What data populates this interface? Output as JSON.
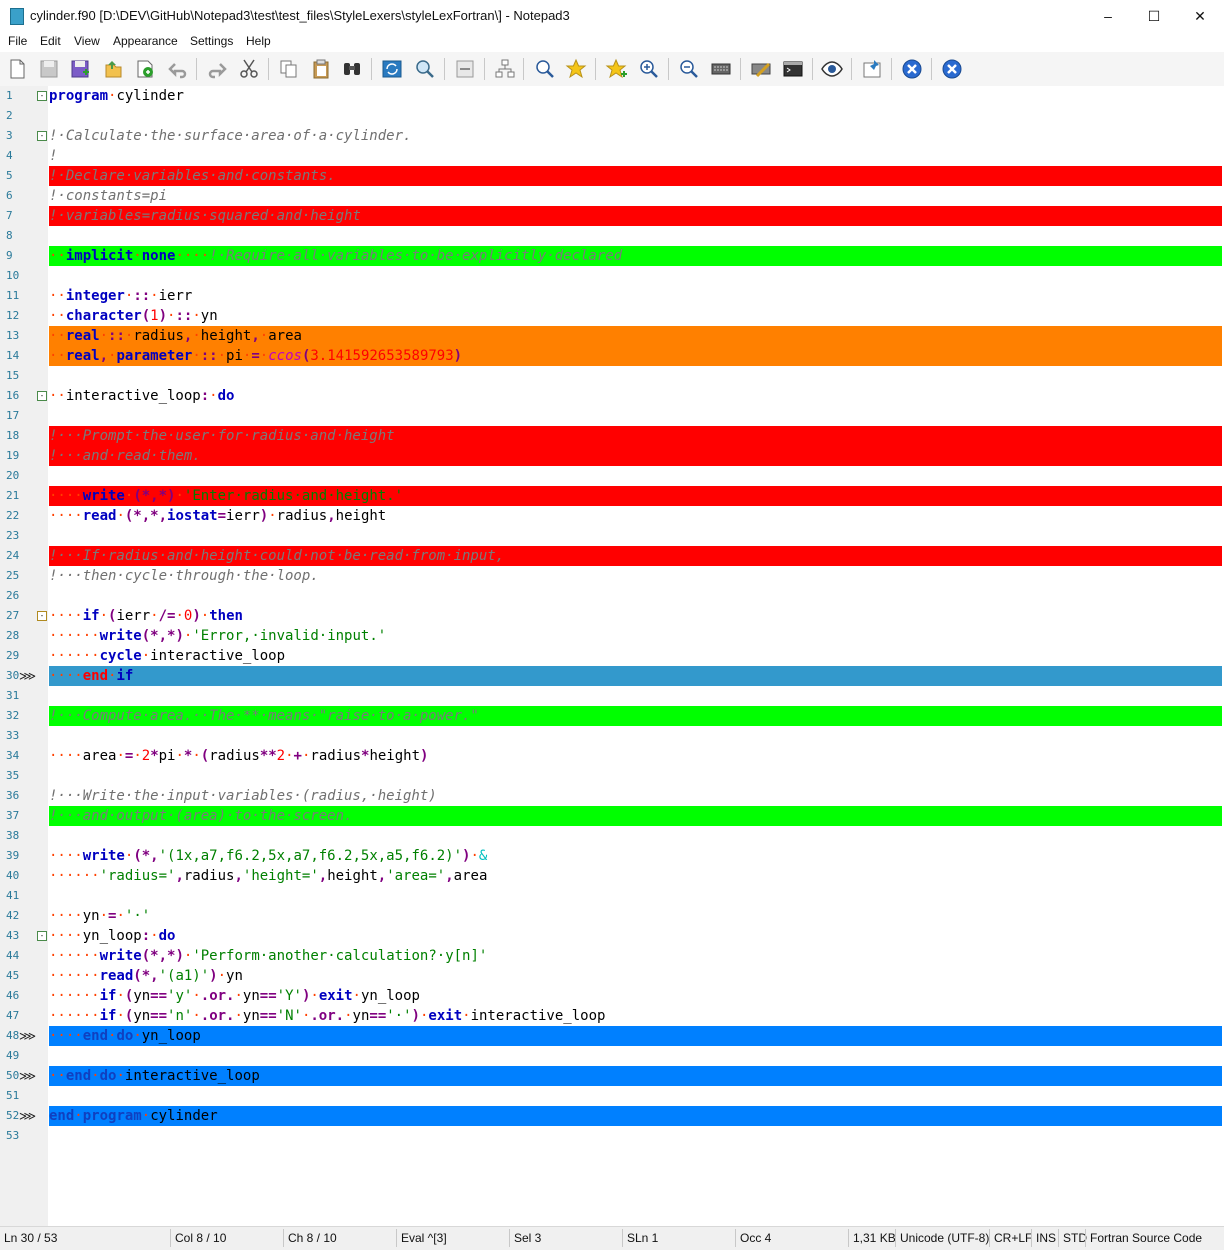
{
  "window": {
    "title": "cylinder.f90 [D:\\DEV\\GitHub\\Notepad3\\test\\test_files\\StyleLexers\\styleLexFortran\\] - Notepad3",
    "minimize": "–",
    "maximize": "☐",
    "close": "✕"
  },
  "menu": [
    "File",
    "Edit",
    "View",
    "Appearance",
    "Settings",
    "Help"
  ],
  "toolbar": [
    "new-file",
    "open",
    "save-disabled",
    "save-as",
    "save-copy",
    "open-favorites",
    "undo",
    "redo",
    "cut",
    "copy",
    "paste",
    "find",
    "replace",
    "goto-line",
    "wrap",
    "show-blanks",
    "lexer",
    "zoom-find",
    "favorites-star",
    "add-favorite",
    "zoom-in",
    "zoom-out",
    "keyboard",
    "customize",
    "terminal",
    "view",
    "pin",
    "exit"
  ],
  "colors": {
    "red": "#ff0000",
    "green": "#00ff00",
    "orange": "#ff8000",
    "caret": "#3399cc",
    "mark": "#0080ff",
    "keyword": "#0000c0",
    "comment": "#707070",
    "string": "#008000",
    "number": "#ff0000",
    "operator": "#800080",
    "ws": "#ff4000"
  },
  "lines": [
    {
      "n": "1",
      "fold": "-",
      "t": [
        [
          "kw",
          "program"
        ],
        [
          "ws",
          "·"
        ],
        [
          "id",
          "cylinder"
        ]
      ]
    },
    {
      "n": "2",
      "t": []
    },
    {
      "n": "3",
      "fold": "-",
      "t": [
        [
          "cm",
          "!·Calculate·the·surface·area·of·a·cylinder."
        ]
      ]
    },
    {
      "n": "4",
      "t": [
        [
          "cm",
          "!"
        ]
      ]
    },
    {
      "n": "5",
      "hl": "red",
      "t": [
        [
          "cm",
          "!·Declare·variables·and·constants."
        ]
      ]
    },
    {
      "n": "6",
      "t": [
        [
          "cm",
          "!·constants=pi"
        ]
      ]
    },
    {
      "n": "7",
      "hl": "red",
      "t": [
        [
          "cm",
          "!·variables=radius·squared·and·height"
        ]
      ]
    },
    {
      "n": "8",
      "t": []
    },
    {
      "n": "9",
      "hl": "green",
      "t": [
        [
          "ws",
          "··"
        ],
        [
          "kw",
          "implicit"
        ],
        [
          "ws",
          "·"
        ],
        [
          "kw",
          "none"
        ],
        [
          "ws",
          "····"
        ],
        [
          "cm",
          "!·Require·all·variables·to·be·explicitly·declared"
        ]
      ]
    },
    {
      "n": "10",
      "t": []
    },
    {
      "n": "11",
      "t": [
        [
          "ws",
          "··"
        ],
        [
          "kw",
          "integer"
        ],
        [
          "ws",
          "·"
        ],
        [
          "op",
          "::"
        ],
        [
          "ws",
          "·"
        ],
        [
          "id",
          "ierr"
        ]
      ]
    },
    {
      "n": "12",
      "t": [
        [
          "ws",
          "··"
        ],
        [
          "kw",
          "character"
        ],
        [
          "op",
          "("
        ],
        [
          "num",
          "1"
        ],
        [
          "op",
          ")"
        ],
        [
          "ws",
          "·"
        ],
        [
          "op",
          "::"
        ],
        [
          "ws",
          "·"
        ],
        [
          "id",
          "yn"
        ]
      ]
    },
    {
      "n": "13",
      "hl": "orange",
      "t": [
        [
          "ws",
          "··"
        ],
        [
          "kw",
          "real"
        ],
        [
          "ws",
          "·"
        ],
        [
          "op",
          "::"
        ],
        [
          "ws",
          "·"
        ],
        [
          "id",
          "radius"
        ],
        [
          "op",
          ","
        ],
        [
          "ws",
          "·"
        ],
        [
          "id",
          "height"
        ],
        [
          "op",
          ","
        ],
        [
          "ws",
          "·"
        ],
        [
          "id",
          "area"
        ]
      ]
    },
    {
      "n": "14",
      "hl": "orange",
      "t": [
        [
          "ws",
          "··"
        ],
        [
          "kw",
          "real"
        ],
        [
          "op",
          ","
        ],
        [
          "ws",
          "·"
        ],
        [
          "kw",
          "parameter"
        ],
        [
          "ws",
          "·"
        ],
        [
          "op",
          "::"
        ],
        [
          "ws",
          "·"
        ],
        [
          "id",
          "pi"
        ],
        [
          "ws",
          "·"
        ],
        [
          "op",
          "="
        ],
        [
          "ws",
          "·"
        ],
        [
          "fn",
          "ccos"
        ],
        [
          "op",
          "("
        ],
        [
          "num",
          "3.141592653589793"
        ],
        [
          "op",
          ")"
        ]
      ]
    },
    {
      "n": "15",
      "t": []
    },
    {
      "n": "16",
      "fold": "-",
      "t": [
        [
          "ws",
          "··"
        ],
        [
          "id",
          "interactive_loop"
        ],
        [
          "op",
          ":"
        ],
        [
          "ws",
          "·"
        ],
        [
          "kw",
          "do"
        ]
      ]
    },
    {
      "n": "17",
      "t": []
    },
    {
      "n": "18",
      "hl": "red",
      "t": [
        [
          "cm",
          "!···Prompt·the·user·for·radius·and·height"
        ]
      ]
    },
    {
      "n": "19",
      "hl": "red",
      "t": [
        [
          "cm",
          "!···and·read·them."
        ]
      ]
    },
    {
      "n": "20",
      "t": []
    },
    {
      "n": "21",
      "hl": "red",
      "t": [
        [
          "ws",
          "····"
        ],
        [
          "kw",
          "write"
        ],
        [
          "ws",
          "·"
        ],
        [
          "op",
          "(*,*)"
        ],
        [
          "ws",
          "·"
        ],
        [
          "str",
          "'Enter·radius·and·height.'"
        ]
      ]
    },
    {
      "n": "22",
      "t": [
        [
          "ws",
          "····"
        ],
        [
          "kw",
          "read"
        ],
        [
          "ws",
          "·"
        ],
        [
          "op",
          "(*,*,"
        ],
        [
          "kw",
          "iostat"
        ],
        [
          "op",
          "="
        ],
        [
          "id",
          "ierr"
        ],
        [
          "op",
          ")"
        ],
        [
          "ws",
          "·"
        ],
        [
          "id",
          "radius"
        ],
        [
          "op",
          ","
        ],
        [
          "id",
          "height"
        ]
      ]
    },
    {
      "n": "23",
      "t": []
    },
    {
      "n": "24",
      "hl": "red",
      "t": [
        [
          "cm",
          "!···If·radius·and·height·could·not·be·read·from·input,"
        ]
      ]
    },
    {
      "n": "25",
      "t": [
        [
          "cm",
          "!···then·cycle·through·the·loop."
        ]
      ]
    },
    {
      "n": "26",
      "t": []
    },
    {
      "n": "27",
      "fold": "-",
      "foldwarn": true,
      "t": [
        [
          "ws",
          "····"
        ],
        [
          "kw",
          "if"
        ],
        [
          "ws",
          "·"
        ],
        [
          "op",
          "("
        ],
        [
          "id",
          "ierr"
        ],
        [
          "ws",
          "·"
        ],
        [
          "op",
          "/="
        ],
        [
          "ws",
          "·"
        ],
        [
          "num",
          "0"
        ],
        [
          "op",
          ")"
        ],
        [
          "ws",
          "·"
        ],
        [
          "kw",
          "then"
        ]
      ]
    },
    {
      "n": "28",
      "t": [
        [
          "ws",
          "······"
        ],
        [
          "kw",
          "write"
        ],
        [
          "op",
          "(*,*)"
        ],
        [
          "ws",
          "·"
        ],
        [
          "str",
          "'Error,·invalid·input.'"
        ]
      ]
    },
    {
      "n": "29",
      "t": [
        [
          "ws",
          "······"
        ],
        [
          "kw",
          "cycle"
        ],
        [
          "ws",
          "·"
        ],
        [
          "id",
          "interactive_loop"
        ]
      ]
    },
    {
      "n": "30",
      "hl": "caret",
      "bm": true,
      "t": [
        [
          "ws",
          "····"
        ],
        [
          "kwr",
          "end"
        ],
        [
          "ws",
          "·"
        ],
        [
          "kw",
          "if"
        ]
      ]
    },
    {
      "n": "31",
      "t": []
    },
    {
      "n": "32",
      "hl": "green",
      "t": [
        [
          "cm",
          "!···Compute·area.··The·**·means·\"raise·to·a·power.\""
        ]
      ]
    },
    {
      "n": "33",
      "t": []
    },
    {
      "n": "34",
      "t": [
        [
          "ws",
          "····"
        ],
        [
          "id",
          "area"
        ],
        [
          "ws",
          "·"
        ],
        [
          "op",
          "="
        ],
        [
          "ws",
          "·"
        ],
        [
          "num",
          "2"
        ],
        [
          "op",
          "*"
        ],
        [
          "id",
          "pi"
        ],
        [
          "ws",
          "·"
        ],
        [
          "op",
          "*"
        ],
        [
          "ws",
          "·"
        ],
        [
          "op",
          "("
        ],
        [
          "id",
          "radius"
        ],
        [
          "op",
          "**"
        ],
        [
          "num",
          "2"
        ],
        [
          "ws",
          "·"
        ],
        [
          "op",
          "+"
        ],
        [
          "ws",
          "·"
        ],
        [
          "id",
          "radius"
        ],
        [
          "op",
          "*"
        ],
        [
          "id",
          "height"
        ],
        [
          "op",
          ")"
        ]
      ]
    },
    {
      "n": "35",
      "t": []
    },
    {
      "n": "36",
      "t": [
        [
          "cm",
          "!···Write·the·input·variables·(radius,·height)"
        ]
      ]
    },
    {
      "n": "37",
      "hl": "green",
      "t": [
        [
          "cm",
          "!···and·output·(area)·to·the·screen."
        ]
      ]
    },
    {
      "n": "38",
      "t": []
    },
    {
      "n": "39",
      "t": [
        [
          "ws",
          "····"
        ],
        [
          "kw",
          "write"
        ],
        [
          "ws",
          "·"
        ],
        [
          "op",
          "(*,"
        ],
        [
          "str",
          "'(1x,a7,f6.2,5x,a7,f6.2,5x,a5,f6.2)'"
        ],
        [
          "op",
          ")"
        ],
        [
          "ws",
          "·"
        ],
        [
          "amp",
          "&"
        ]
      ]
    },
    {
      "n": "40",
      "t": [
        [
          "ws",
          "······"
        ],
        [
          "str",
          "'radius='"
        ],
        [
          "op",
          ","
        ],
        [
          "id",
          "radius"
        ],
        [
          "op",
          ","
        ],
        [
          "str",
          "'height='"
        ],
        [
          "op",
          ","
        ],
        [
          "id",
          "height"
        ],
        [
          "op",
          ","
        ],
        [
          "str",
          "'area='"
        ],
        [
          "op",
          ","
        ],
        [
          "id",
          "area"
        ]
      ]
    },
    {
      "n": "41",
      "t": []
    },
    {
      "n": "42",
      "t": [
        [
          "ws",
          "····"
        ],
        [
          "id",
          "yn"
        ],
        [
          "ws",
          "·"
        ],
        [
          "op",
          "="
        ],
        [
          "ws",
          "·"
        ],
        [
          "str",
          "'·'"
        ]
      ]
    },
    {
      "n": "43",
      "fold": "-",
      "t": [
        [
          "ws",
          "····"
        ],
        [
          "id",
          "yn_loop"
        ],
        [
          "op",
          ":"
        ],
        [
          "ws",
          "·"
        ],
        [
          "kw",
          "do"
        ]
      ]
    },
    {
      "n": "44",
      "t": [
        [
          "ws",
          "······"
        ],
        [
          "kw",
          "write"
        ],
        [
          "op",
          "(*,*)"
        ],
        [
          "ws",
          "·"
        ],
        [
          "str",
          "'Perform·another·calculation?·y[n]'"
        ]
      ]
    },
    {
      "n": "45",
      "t": [
        [
          "ws",
          "······"
        ],
        [
          "kw",
          "read"
        ],
        [
          "op",
          "(*,"
        ],
        [
          "str",
          "'(a1)'"
        ],
        [
          "op",
          ")"
        ],
        [
          "ws",
          "·"
        ],
        [
          "id",
          "yn"
        ]
      ]
    },
    {
      "n": "46",
      "t": [
        [
          "ws",
          "······"
        ],
        [
          "kw",
          "if"
        ],
        [
          "ws",
          "·"
        ],
        [
          "op",
          "("
        ],
        [
          "id",
          "yn"
        ],
        [
          "op",
          "=="
        ],
        [
          "str",
          "'y'"
        ],
        [
          "ws",
          "·"
        ],
        [
          "op",
          ".or."
        ],
        [
          "ws",
          "·"
        ],
        [
          "id",
          "yn"
        ],
        [
          "op",
          "=="
        ],
        [
          "str",
          "'Y'"
        ],
        [
          "op",
          ")"
        ],
        [
          "ws",
          "·"
        ],
        [
          "kw",
          "exit"
        ],
        [
          "ws",
          "·"
        ],
        [
          "id",
          "yn_loop"
        ]
      ]
    },
    {
      "n": "47",
      "t": [
        [
          "ws",
          "······"
        ],
        [
          "kw",
          "if"
        ],
        [
          "ws",
          "·"
        ],
        [
          "op",
          "("
        ],
        [
          "id",
          "yn"
        ],
        [
          "op",
          "=="
        ],
        [
          "str",
          "'n'"
        ],
        [
          "ws",
          "·"
        ],
        [
          "op",
          ".or."
        ],
        [
          "ws",
          "·"
        ],
        [
          "id",
          "yn"
        ],
        [
          "op",
          "=="
        ],
        [
          "str",
          "'N'"
        ],
        [
          "ws",
          "·"
        ],
        [
          "op",
          ".or."
        ],
        [
          "ws",
          "·"
        ],
        [
          "id",
          "yn"
        ],
        [
          "op",
          "=="
        ],
        [
          "str",
          "'·'"
        ],
        [
          "op",
          ")"
        ],
        [
          "ws",
          "·"
        ],
        [
          "kw",
          "exit"
        ],
        [
          "ws",
          "·"
        ],
        [
          "id",
          "interactive_loop"
        ]
      ]
    },
    {
      "n": "48",
      "hl": "mark",
      "bm": true,
      "t": [
        [
          "ws",
          "····"
        ],
        [
          "kw",
          "end"
        ],
        [
          "ws",
          "·"
        ],
        [
          "kw",
          "do"
        ],
        [
          "ws",
          "·"
        ],
        [
          "id",
          "yn_loop"
        ]
      ]
    },
    {
      "n": "49",
      "t": []
    },
    {
      "n": "50",
      "hl": "mark",
      "bm": true,
      "t": [
        [
          "ws",
          "··"
        ],
        [
          "kw",
          "end"
        ],
        [
          "ws",
          "·"
        ],
        [
          "kw",
          "do"
        ],
        [
          "ws",
          "·"
        ],
        [
          "id",
          "interactive_loop"
        ]
      ]
    },
    {
      "n": "51",
      "t": []
    },
    {
      "n": "52",
      "hl": "mark",
      "bm": true,
      "t": [
        [
          "kw",
          "end"
        ],
        [
          "ws",
          "·"
        ],
        [
          "kw",
          "program"
        ],
        [
          "ws",
          "·"
        ],
        [
          "id",
          "cylinder"
        ]
      ]
    },
    {
      "n": "53",
      "t": []
    }
  ],
  "status": {
    "ln": "Ln  30 / 53",
    "col": "Col  8 / 10",
    "ch": "Ch  8 / 10",
    "eval": "Eval  ^[3]",
    "sel": "Sel  3",
    "sln": "SLn  1",
    "occ": "Occ  4",
    "size": "1,31 KB",
    "encoding": "Unicode (UTF-8)",
    "eol": "CR+LF",
    "ins": "INS",
    "std": "STD",
    "lexer": "Fortran Source Code"
  }
}
